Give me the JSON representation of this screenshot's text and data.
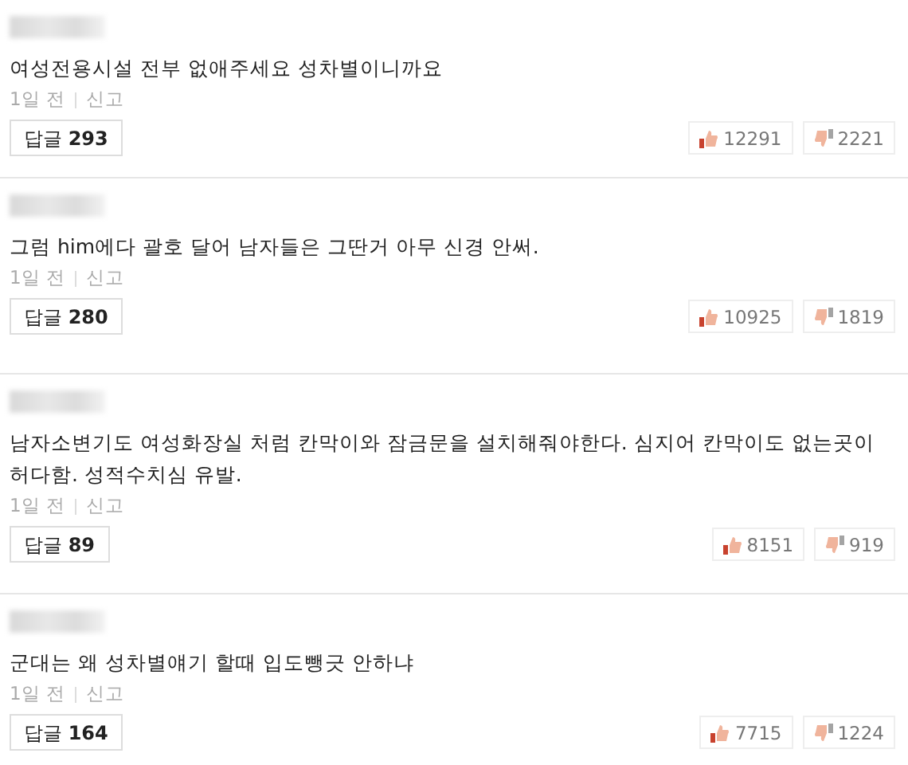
{
  "comments": [
    {
      "text": "여성전용시설 전부 없애주세요 성차별이니까요",
      "time": "1일 전",
      "report": "신고",
      "reply": "답글 **293**",
      "likes": "12291",
      "dislikes": "2221"
    },
    {
      "text": "그럼 him에다 괄호 달어 남자들은 그딴거 아무 신경 안써.",
      "time": "1일 전",
      "report": "신고",
      "reply": "답글 **280**",
      "likes": "10925",
      "dislikes": "1819"
    },
    {
      "text": "남자소변기도 여성화장실 처럼 칸막이와 잠금문을 설치해줘야한다. 심지어 칸막이도 없는곳이 허다함. 성적수치심 유발.",
      "time": "1일 전",
      "report": "신고",
      "reply": "답글 **89**",
      "likes": "8151",
      "dislikes": "919"
    },
    {
      "text": "군대는 왜 성차별얘기 할때 입도뺑긋 안하냐",
      "time": "1일 전",
      "report": "신고",
      "reply": "답글 **164**",
      "likes": "7715",
      "dislikes": "1224"
    }
  ]
}
